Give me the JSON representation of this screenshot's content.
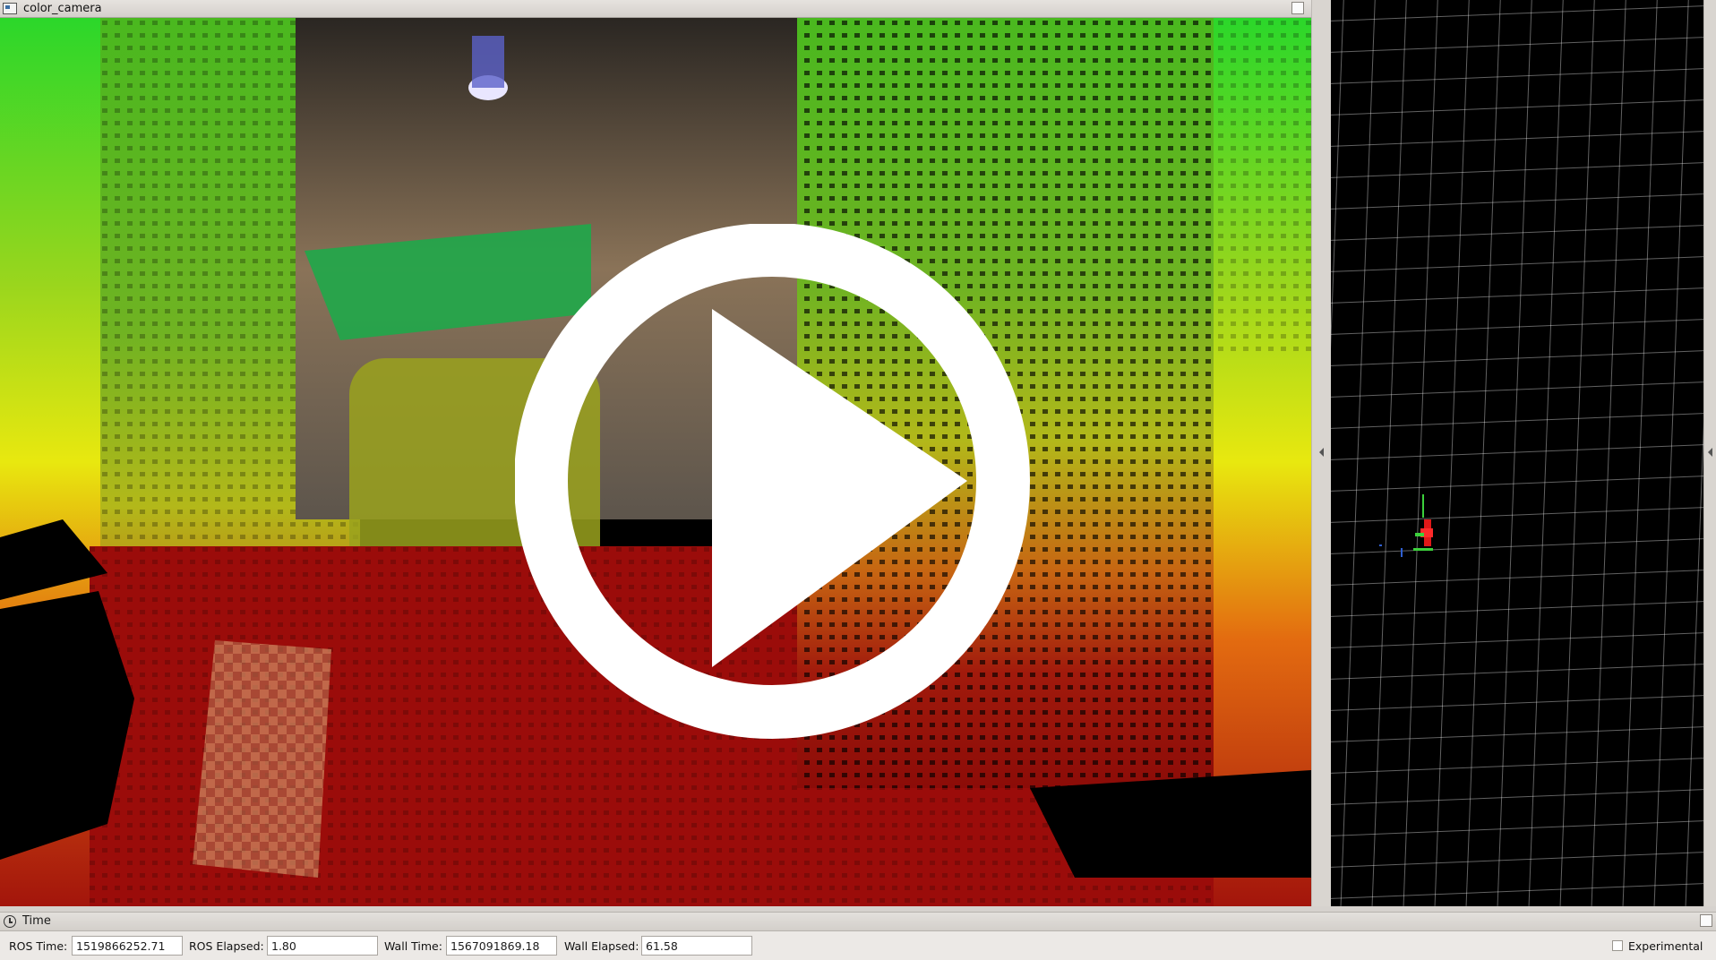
{
  "camera_panel": {
    "title": "color_camera",
    "window_icon": "window-icon",
    "float_icon": "float-window-icon"
  },
  "time_panel": {
    "title": "Time",
    "ros_time_label": "ROS Time:",
    "ros_time_value": "1519866252.71",
    "ros_elapsed_label": "ROS Elapsed:",
    "ros_elapsed_value": "1.80",
    "wall_time_label": "Wall Time:",
    "wall_time_value": "1567091869.18",
    "wall_elapsed_label": "Wall Elapsed:",
    "wall_elapsed_value": "61.58",
    "experimental_label": "Experimental",
    "experimental_checked": false
  },
  "overlay": {
    "icon": "play-icon"
  },
  "colors": {
    "point_far": "#00ff00",
    "point_mid": "#ffff00",
    "point_near": "#ff0000",
    "view3d_background": "#000000",
    "grid_line": "#ffffff",
    "panel_background": "#d6d2ce"
  }
}
